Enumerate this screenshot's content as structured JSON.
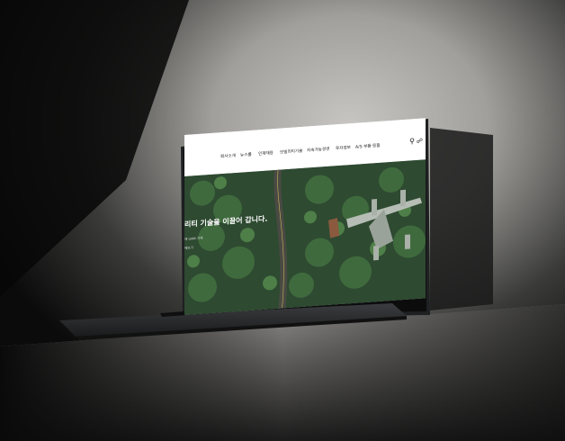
{
  "scene": {
    "description_label": "Laptop mockup on concrete ledge",
    "colors": {
      "background": "#0a0a0a",
      "wall": "#9a9996",
      "ledge": "#6e6d6b",
      "laptop_body": "#2b2c2e"
    }
  },
  "website": {
    "nav": [
      "회사소개",
      "뉴스룸",
      "인재채용",
      "모빌리티기술",
      "지속가능경영",
      "투자정보",
      "A/S 부품·용품"
    ],
    "search_icon": "search-icon",
    "share_icon": "share-icon",
    "hero": {
      "headline": "리티 기술을 이끌어 갑니다.",
      "subtext_1": "에 UAM 기체",
      "subtext_2": "해보기"
    }
  }
}
